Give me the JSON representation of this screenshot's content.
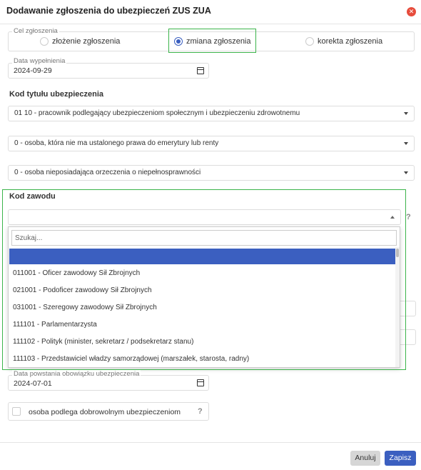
{
  "modal": {
    "title": "Dodawanie zgłoszenia do ubezpieczeń ZUS ZUA",
    "close_icon": "close-icon",
    "close_color": "#e74c3c"
  },
  "cel": {
    "legend": "Cel zgłoszenia",
    "options": [
      "złożenie zgłoszenia",
      "zmiana zgłoszenia",
      "korekta zgłoszenia"
    ],
    "selected": "zmiana zgłoszenia"
  },
  "data_wypelnienia": {
    "legend": "Data wypełnienia",
    "value": "2024-09-29",
    "icon": "calendar-icon"
  },
  "kod_tytulu": {
    "title": "Kod tytułu ubezpieczenia",
    "select1": "01 10 - pracownik podlegający ubezpieczeniom społecznym i ubezpieczeniu zdrowotnemu",
    "select2": "0 - osoba, która nie ma ustalonego prawa do emerytury lub renty",
    "select3": "0 - osoba nieposiadająca orzeczenia o niepełnosprawności"
  },
  "kod_zawodu": {
    "title": "Kod zawodu",
    "value": "",
    "help": "?",
    "search_placeholder": "Szukaj...",
    "options": [
      "011001 - Oficer zawodowy Sił Zbrojnych",
      "021001 - Podoficer zawodowy Sił Zbrojnych",
      "031001 - Szeregowy zawodowy Sił Zbrojnych",
      "111101 - Parlamentarzysta",
      "111102 - Polityk (minister, sekretarz / podsekretarz stanu)",
      "111103 - Przedstawiciel władzy samorządowej (marszałek, starosta, radny)"
    ]
  },
  "data_powstania": {
    "legend": "Data powstania obowiązku ubezpieczenia",
    "value": "2024-07-01",
    "icon": "calendar-icon"
  },
  "dobrowolne": {
    "label": "osoba podlega dobrowolnym ubezpieczeniom",
    "help": "?"
  },
  "footer": {
    "cancel": "Anuluj",
    "save": "Zapisz"
  },
  "colors": {
    "accent": "#3b5fc0",
    "highlight_frame": "#3cb44b"
  }
}
